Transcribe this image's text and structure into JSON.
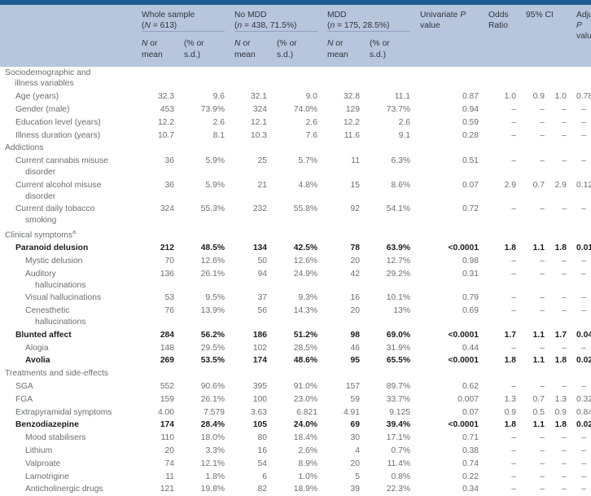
{
  "table": {
    "header": {
      "groups": [
        {
          "name": "label-col",
          "line1": "",
          "line2": ""
        },
        {
          "name": "whole-sample",
          "line1": "Whole sample",
          "line2_prefix": "(",
          "line2_italic": "N",
          "line2_rest": " = 613)"
        },
        {
          "name": "no-mdd",
          "line1": "No MDD",
          "line2_prefix": "(",
          "line2_italic": "n",
          "line2_rest": " = 438, 71.5%)"
        },
        {
          "name": "mdd",
          "line1": "MDD",
          "line2_prefix": "(",
          "line2_italic": "n",
          "line2_rest": " = 175, 28.5%)"
        }
      ],
      "whole_sample": "Whole sample",
      "whole_sample_n": "(N = 613)",
      "no_mdd": "No MDD",
      "no_mdd_n": "(n = 438, 71.5%)",
      "mdd": "MDD",
      "mdd_n": "(n = 175, 28.5%)",
      "univariate_p": "Univariate P",
      "univariate_p_l2": "value",
      "odds": "Odds",
      "odds_l2": "Ratio",
      "ci": "95% CI",
      "adjusted_p": "Adjusted P",
      "adjusted_p_l2": "value*",
      "sub_n": "N or",
      "sub_mean": "mean",
      "sub_pct": "(% or",
      "sub_sd": "s.d.)"
    },
    "rows": [
      {
        "name": "section-sociodemographic",
        "type": "section",
        "indent": 0,
        "label": "Sociodemographic and",
        "label2": "illness variables",
        "bold": false,
        "cells": [
          "",
          "",
          "",
          "",
          "",
          "",
          "",
          "",
          "",
          "",
          ""
        ]
      },
      {
        "name": "row-age",
        "type": "data",
        "indent": 1,
        "label": "Age (years)",
        "bold": false,
        "cells": [
          "32.3",
          "9.6",
          "32.1",
          "9.0",
          "32.8",
          "11.1",
          "0.87",
          "1.0",
          "0.9",
          "1.0",
          "0.78"
        ]
      },
      {
        "name": "row-gender-male",
        "type": "data",
        "indent": 1,
        "label": "Gender (male)",
        "bold": false,
        "cells": [
          "453",
          "73.9%",
          "324",
          "74.0%",
          "129",
          "73.7%",
          "0.94",
          "–",
          "–",
          "–",
          "–"
        ]
      },
      {
        "name": "row-education-level",
        "type": "data",
        "indent": 1,
        "label": "Education level (years)",
        "bold": false,
        "cells": [
          "12.2",
          "2.6",
          "12.1",
          "2.6",
          "12.2",
          "2.6",
          "0.59",
          "–",
          "–",
          "–",
          "–"
        ]
      },
      {
        "name": "row-illness-duration",
        "type": "data",
        "indent": 1,
        "label": "Illness duration (years)",
        "bold": false,
        "cells": [
          "10.7",
          "8.1",
          "10.3",
          "7.6",
          "11.6",
          "9.1",
          "0.28",
          "–",
          "–",
          "–",
          "–"
        ]
      },
      {
        "name": "section-addictions",
        "type": "section",
        "indent": 0,
        "label": "Addictions",
        "label2": "",
        "bold": false,
        "cells": [
          "",
          "",
          "",
          "",
          "",
          "",
          "",
          "",
          "",
          "",
          ""
        ]
      },
      {
        "name": "row-cannabis-misuse",
        "type": "data",
        "indent": 1,
        "label": "Current cannabis misuse",
        "label2": "disorder",
        "bold": false,
        "cells": [
          "36",
          "5.9%",
          "25",
          "5.7%",
          "11",
          "6.3%",
          "0.51",
          "–",
          "–",
          "–",
          "–"
        ]
      },
      {
        "name": "row-alcohol-misuse",
        "type": "data",
        "indent": 1,
        "label": "Current alcohol misuse",
        "label2": "disorder",
        "bold": false,
        "cells": [
          "36",
          "5.9%",
          "21",
          "4.8%",
          "15",
          "8.6%",
          "0.07",
          "2.9",
          "0.7",
          "2.9",
          "0.12"
        ]
      },
      {
        "name": "row-tobacco-smoking",
        "type": "data",
        "indent": 1,
        "label": "Current daily tobacco",
        "label2": "smoking",
        "bold": false,
        "cells": [
          "324",
          "55.3%",
          "232",
          "55.8%",
          "92",
          "54.1%",
          "0.72",
          "–",
          "–",
          "–",
          "–"
        ]
      },
      {
        "name": "section-clinical-symptoms",
        "type": "section",
        "indent": 0,
        "label": "Clinical symptoms",
        "sup": "a",
        "label2": "",
        "bold": false,
        "cells": [
          "",
          "",
          "",
          "",
          "",
          "",
          "",
          "",
          "",
          "",
          ""
        ]
      },
      {
        "name": "row-paranoid-delusion",
        "type": "data",
        "indent": 1,
        "label": "Paranoid delusion",
        "bold": true,
        "cells": [
          "212",
          "48.5%",
          "134",
          "42.5%",
          "78",
          "63.9%",
          "<0.0001",
          "1.8",
          "1.1",
          "1.8",
          "0.01"
        ]
      },
      {
        "name": "row-mystic-delusion",
        "type": "data",
        "indent": 2,
        "label": "Mystic delusion",
        "bold": false,
        "cells": [
          "70",
          "12.6%",
          "50",
          "12.6%",
          "20",
          "12.7%",
          "0.98",
          "–",
          "–",
          "–",
          "–"
        ]
      },
      {
        "name": "row-auditory-hallucinations",
        "type": "data",
        "indent": 2,
        "label": "Auditory",
        "label2": "hallucinations",
        "bold": false,
        "cells": [
          "136",
          "26.1%",
          "94",
          "24.9%",
          "42",
          "29.2%",
          "0.31",
          "–",
          "–",
          "–",
          "–"
        ]
      },
      {
        "name": "row-visual-hallucinations",
        "type": "data",
        "indent": 2,
        "label": "Visual hallucinations",
        "bold": false,
        "cells": [
          "53",
          "9.5%",
          "37",
          "9.3%",
          "16",
          "10.1%",
          "0.79",
          "–",
          "–",
          "–",
          "–"
        ]
      },
      {
        "name": "row-cenesthetic-hallucinations",
        "type": "data",
        "indent": 2,
        "label": "Cenesthetic",
        "label2": "hallucinations",
        "bold": false,
        "cells": [
          "76",
          "13.9%",
          "56",
          "14.3%",
          "20",
          "13%",
          "0.69",
          "–",
          "–",
          "–",
          "–"
        ]
      },
      {
        "name": "row-blunted-affect",
        "type": "data",
        "indent": 1,
        "label": "Blunted affect",
        "bold": true,
        "cells": [
          "284",
          "56.2%",
          "186",
          "51.2%",
          "98",
          "69.0%",
          "<0.0001",
          "1.7",
          "1.1",
          "1.7",
          "0.04"
        ]
      },
      {
        "name": "row-alogia",
        "type": "data",
        "indent": 2,
        "label": "Alogia",
        "bold": false,
        "cells": [
          "148",
          "29.5%",
          "102",
          "28.5%",
          "46",
          "31.9%",
          "0.44",
          "–",
          "–",
          "–",
          "–"
        ]
      },
      {
        "name": "row-avolia",
        "type": "data",
        "indent": 2,
        "label": "Avolia",
        "bold": true,
        "cells": [
          "269",
          "53.5%",
          "174",
          "48.6%",
          "95",
          "65.5%",
          "<0.0001",
          "1.8",
          "1.1",
          "1.8",
          "0.02"
        ]
      },
      {
        "name": "section-treatments-side-effects",
        "type": "section",
        "indent": 0,
        "label": "Treatments and side-effects",
        "label2": "",
        "bold": false,
        "cells": [
          "",
          "",
          "",
          "",
          "",
          "",
          "",
          "",
          "",
          "",
          ""
        ]
      },
      {
        "name": "row-sga",
        "type": "data",
        "indent": 1,
        "label": "SGA",
        "bold": false,
        "cells": [
          "552",
          "90.6%",
          "395",
          "91.0%",
          "157",
          "89.7%",
          "0.62",
          "–",
          "–",
          "–",
          "–"
        ]
      },
      {
        "name": "row-fga",
        "type": "data",
        "indent": 1,
        "label": "FGA",
        "bold": false,
        "cells": [
          "159",
          "26.1%",
          "100",
          "23.0%",
          "59",
          "33.7%",
          "0.007",
          "1.3",
          "0.7",
          "1.3",
          "0.32"
        ]
      },
      {
        "name": "row-extrapyramidal-symptoms",
        "type": "data",
        "indent": 1,
        "label": "Extrapyramidal symptoms",
        "bold": false,
        "cells": [
          "4.00",
          "7.579",
          "3.63",
          "6.821",
          "4.91",
          "9.125",
          "0.07",
          "0.9",
          "0.5",
          "0.9",
          "0.84"
        ]
      },
      {
        "name": "row-benzodiazepine",
        "type": "data",
        "indent": 1,
        "label": "Benzodiazepine",
        "bold": true,
        "cells": [
          "174",
          "28.4%",
          "105",
          "24.0%",
          "69",
          "39.4%",
          "<0.0001",
          "1.8",
          "1.1",
          "1.8",
          "0.02"
        ]
      },
      {
        "name": "row-mood-stabilisers",
        "type": "data",
        "indent": 2,
        "label": "Mood stabilisers",
        "bold": false,
        "cells": [
          "110",
          "18.0%",
          "80",
          "18.4%",
          "30",
          "17.1%",
          "0.71",
          "–",
          "–",
          "–",
          "–"
        ]
      },
      {
        "name": "row-lithium",
        "type": "data",
        "indent": 2,
        "label": "Lithium",
        "bold": false,
        "cells": [
          "20",
          "3.3%",
          "16",
          "2.6%",
          "4",
          "0.7%",
          "0.38",
          "–",
          "–",
          "–",
          "–"
        ]
      },
      {
        "name": "row-valproate",
        "type": "data",
        "indent": 2,
        "label": "Valproate",
        "bold": false,
        "cells": [
          "74",
          "12.1%",
          "54",
          "8.9%",
          "20",
          "11.4%",
          "0.74",
          "–",
          "–",
          "–",
          "–"
        ]
      },
      {
        "name": "row-lamotrigine",
        "type": "data",
        "indent": 2,
        "label": "Lamotrigine",
        "bold": false,
        "cells": [
          "11",
          "1.8%",
          "6",
          "1.0%",
          "5",
          "0.8%",
          "0.22",
          "–",
          "–",
          "–",
          "–"
        ]
      },
      {
        "name": "row-anticholinergic-drugs",
        "type": "data",
        "indent": 2,
        "label": "Anticholinergic drugs",
        "bold": false,
        "cells": [
          "121",
          "19.8%",
          "82",
          "18.9%",
          "39",
          "22.3%",
          "0.34",
          "–",
          "–",
          "–",
          "–"
        ]
      }
    ]
  },
  "colors": {
    "title_strip": "#1d5c92",
    "header_band": "#b7c6dd",
    "body_text": "#6c6d70",
    "bold_text": "#1c1c1c"
  }
}
